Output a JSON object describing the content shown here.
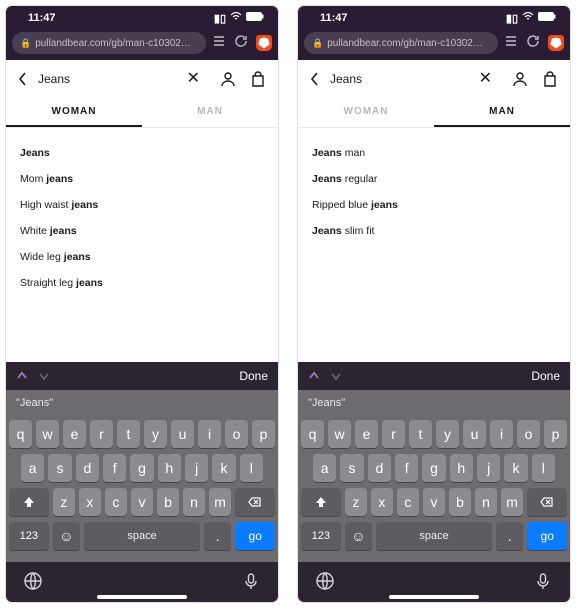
{
  "statusbar": {
    "time": "11:47"
  },
  "urlbar": {
    "url": "pullandbear.com/gb/man-c10302…"
  },
  "search": {
    "term": "Jeans"
  },
  "tabs": {
    "woman": "WOMAN",
    "man": "MAN"
  },
  "left": {
    "suggestions": [
      {
        "pre": "",
        "bold": "Jeans",
        "post": ""
      },
      {
        "pre": "Mom ",
        "bold": "jeans",
        "post": ""
      },
      {
        "pre": "High waist ",
        "bold": "jeans",
        "post": ""
      },
      {
        "pre": "White ",
        "bold": "jeans",
        "post": ""
      },
      {
        "pre": "Wide leg ",
        "bold": "jeans",
        "post": ""
      },
      {
        "pre": "Straight leg ",
        "bold": "jeans",
        "post": ""
      }
    ]
  },
  "right": {
    "suggestions": [
      {
        "pre": "",
        "bold": "Jeans",
        "post": " man"
      },
      {
        "pre": "",
        "bold": "Jeans",
        "post": " regular"
      },
      {
        "pre": "Ripped blue ",
        "bold": "jeans",
        "post": ""
      },
      {
        "pre": "",
        "bold": "Jeans",
        "post": " slim fit"
      }
    ]
  },
  "keyboard": {
    "done": "Done",
    "suggest": "\"Jeans\"",
    "row1": [
      "q",
      "w",
      "e",
      "r",
      "t",
      "y",
      "u",
      "i",
      "o",
      "p"
    ],
    "row2": [
      "a",
      "s",
      "d",
      "f",
      "g",
      "h",
      "j",
      "k",
      "l"
    ],
    "row3": [
      "z",
      "x",
      "c",
      "v",
      "b",
      "n",
      "m"
    ],
    "k123": "123",
    "space": "space",
    "dot": ".",
    "go": "go"
  }
}
